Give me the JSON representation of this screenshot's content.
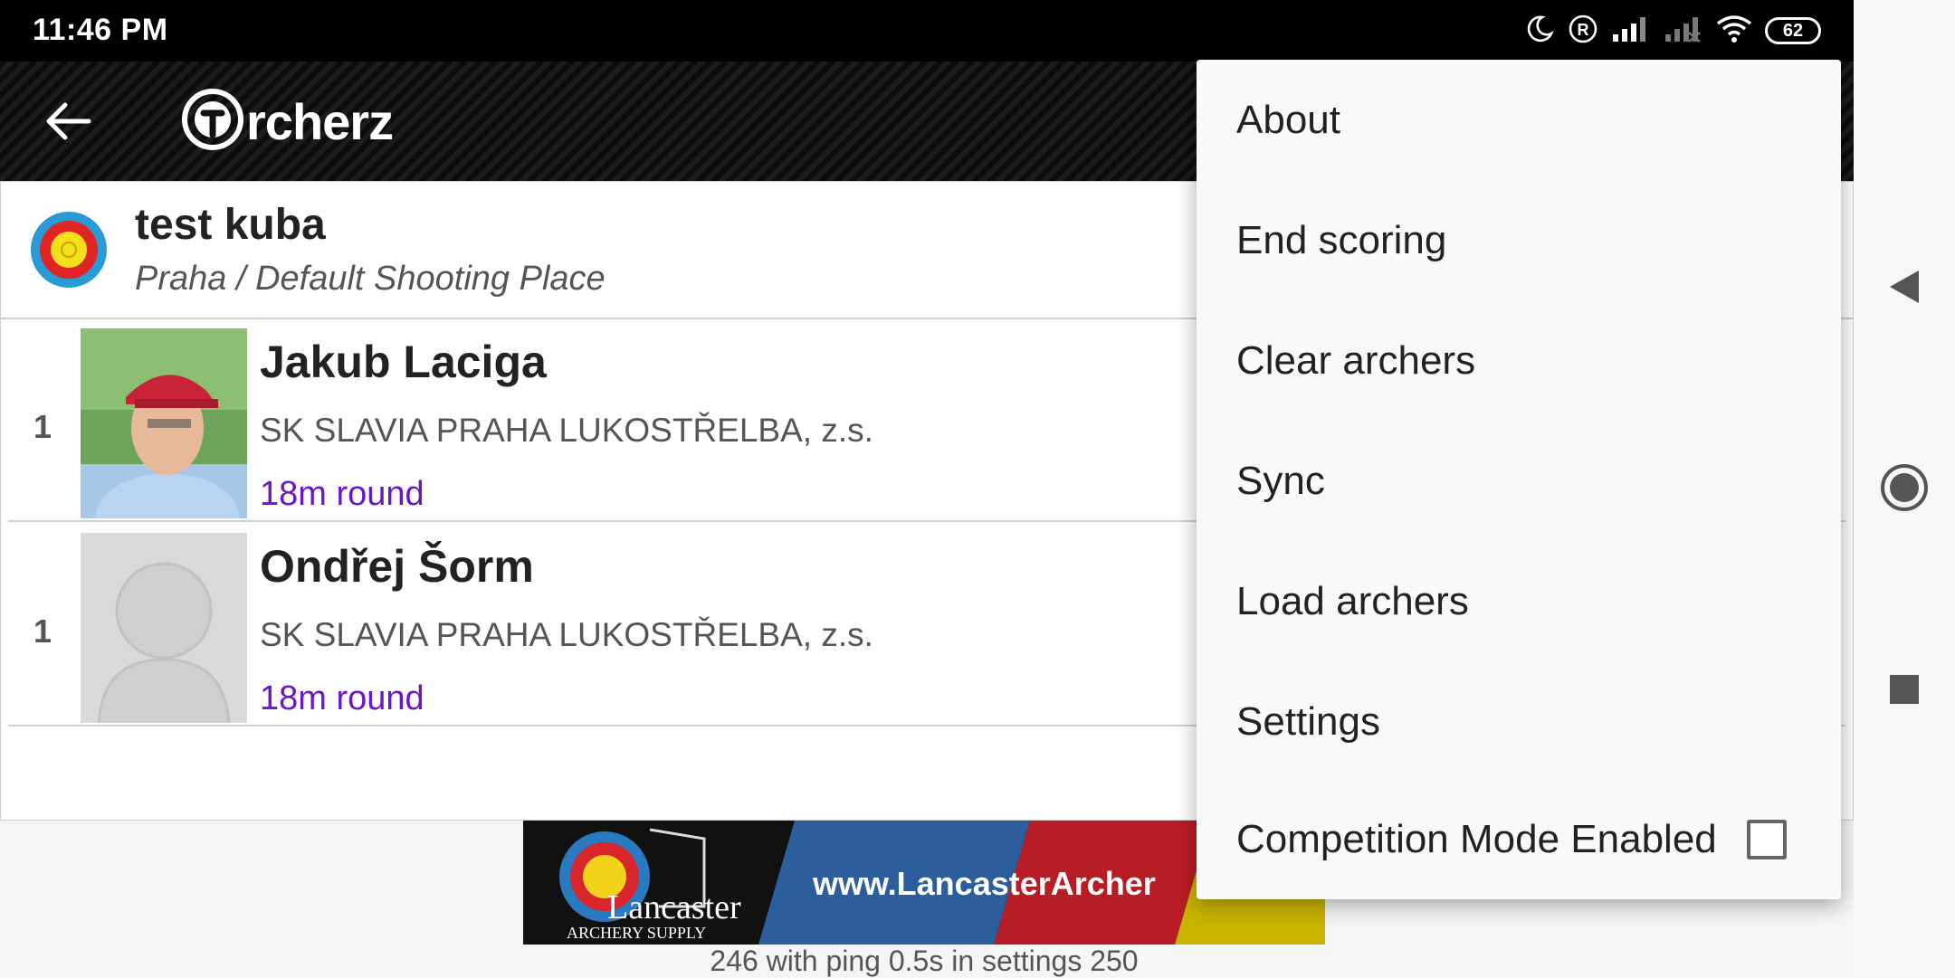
{
  "status_bar": {
    "time": "11:46 PM",
    "battery": "62",
    "icons": [
      "moon-icon",
      "registered-icon",
      "signal-icon",
      "signal-off-icon",
      "wifi-icon",
      "battery-icon"
    ]
  },
  "app_bar": {
    "logo_text": "rcherz"
  },
  "event": {
    "name": "test kuba",
    "place": "Praha / Default Shooting Place"
  },
  "archers": [
    {
      "rank": "1",
      "name": "Jakub Laciga",
      "club": "SK SLAVIA PRAHA LUKOSTŘELBA, z.s.",
      "round": "18m round"
    },
    {
      "rank": "1",
      "name": "Ondřej Šorm",
      "club": "SK SLAVIA PRAHA LUKOSTŘELBA, z.s.",
      "round": "18m round"
    }
  ],
  "ad": {
    "brand_line1": "Lancaster",
    "brand_line2": "ARCHERY SUPPLY",
    "url_text": "www.LancasterArcher",
    "footer": "246 with ping 0.5s in settings 250"
  },
  "menu": {
    "items": [
      "About",
      "End scoring",
      "Clear archers",
      "Sync",
      "Load archers",
      "Settings"
    ],
    "competition_mode_label": "Competition Mode Enabled",
    "competition_mode_checked": false
  },
  "colors": {
    "round_text": "#6a16c9",
    "status_bar_bg": "#000000"
  }
}
